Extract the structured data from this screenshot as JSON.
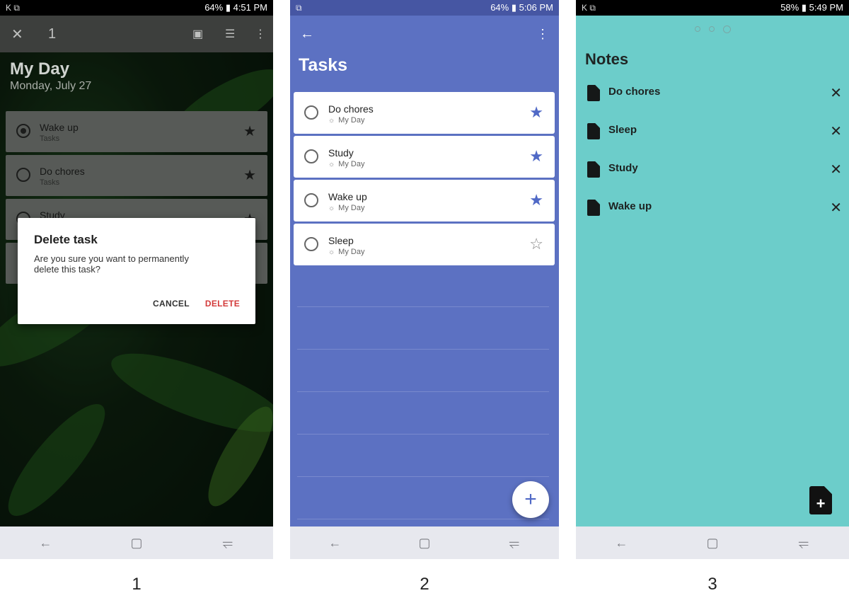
{
  "screen1": {
    "status": {
      "left": "K ⧉",
      "right": "64% ▮ 4:51 PM"
    },
    "appbar": {
      "close": "✕",
      "count": "1"
    },
    "title": "My Day",
    "date": "Monday, July 27",
    "tasks": [
      {
        "title": "Wake up",
        "list": "Tasks"
      },
      {
        "title": "Do chores",
        "list": "Tasks"
      },
      {
        "title": "Study",
        "list": ""
      }
    ],
    "dialog": {
      "heading": "Delete task",
      "body": "Are you sure you want to permanently delete this task?",
      "cancel": "CANCEL",
      "delete": "DELETE"
    },
    "label": "1"
  },
  "screen2": {
    "status": {
      "left": "⧉",
      "right": "64% ▮ 5:06 PM"
    },
    "title": "Tasks",
    "tasks": [
      {
        "title": "Do chores",
        "list": "My Day",
        "starred": true
      },
      {
        "title": "Study",
        "list": "My Day",
        "starred": true
      },
      {
        "title": "Wake up",
        "list": "My Day",
        "starred": true
      },
      {
        "title": "Sleep",
        "list": "My Day",
        "starred": false
      }
    ],
    "fab": "+",
    "label": "2"
  },
  "screen3": {
    "status": {
      "left": "K ⧉",
      "right": "58% ▮ 5:49 PM"
    },
    "title": "Notes",
    "notes": [
      "Do chores",
      "Sleep",
      "Study",
      "Wake up"
    ],
    "label": "3"
  },
  "colors": {
    "task_accent": "#5c71c2",
    "notes_bg": "#6ccdca",
    "delete_red": "#d33a3a"
  }
}
